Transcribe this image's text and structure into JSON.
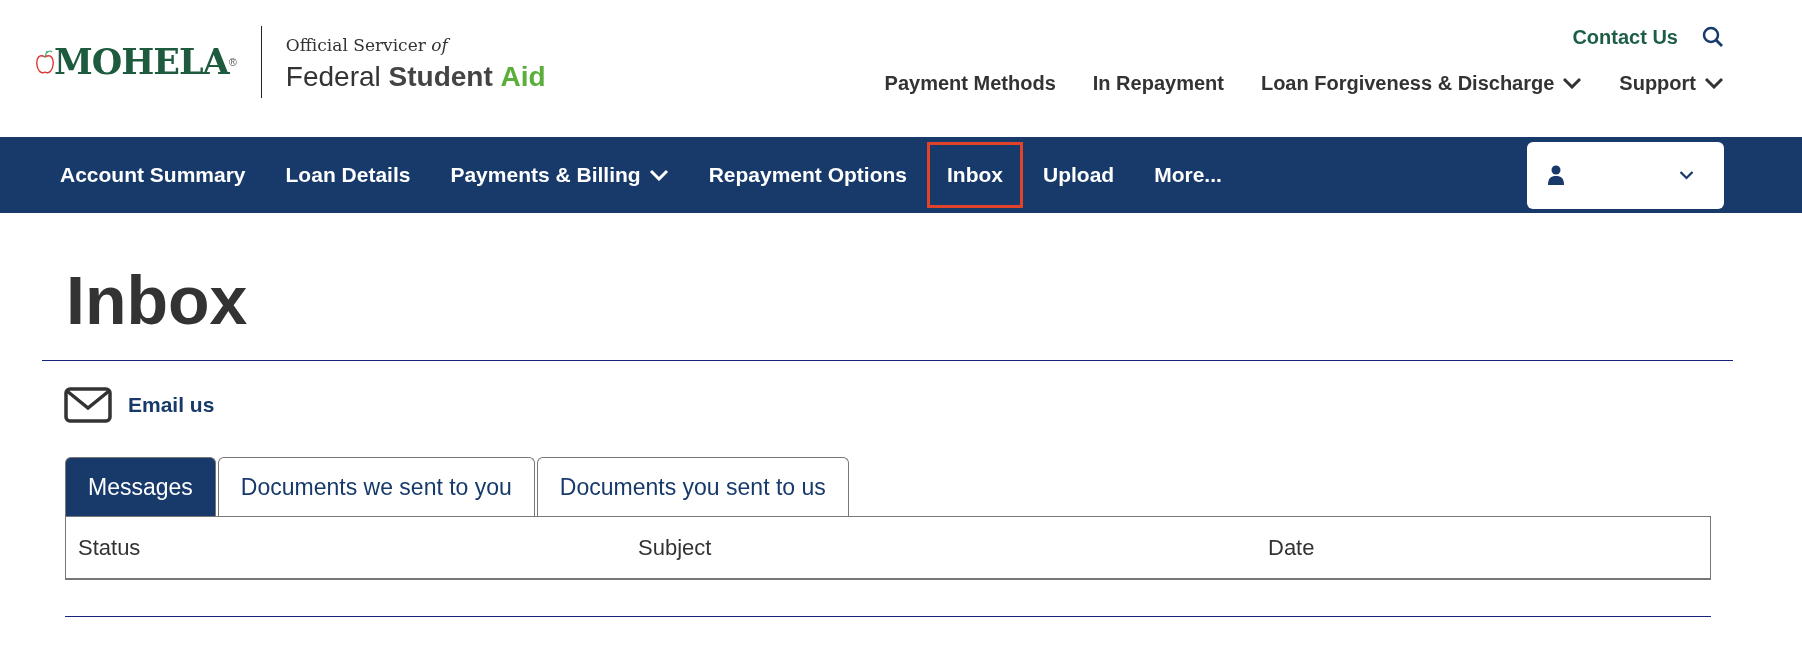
{
  "logo": {
    "brand": "MOHELA",
    "registered": "®",
    "servicer_line": "Official Servicer",
    "servicer_italic": "of",
    "fsa_parts": [
      {
        "text": "Federal",
        "kind": "light"
      },
      {
        "text": "Student",
        "kind": "bold"
      },
      {
        "text": "Aid",
        "kind": "accent"
      }
    ]
  },
  "utility_links": [
    {
      "label": "Contact Us"
    }
  ],
  "top_nav": [
    {
      "label": "Payment Methods",
      "dropdown": false
    },
    {
      "label": "In Repayment",
      "dropdown": false
    },
    {
      "label": "Loan Forgiveness & Discharge",
      "dropdown": true
    },
    {
      "label": "Support",
      "dropdown": true
    }
  ],
  "main_nav": [
    {
      "label": "Account Summary",
      "dropdown": false,
      "selected": false
    },
    {
      "label": "Loan Details",
      "dropdown": false,
      "selected": false
    },
    {
      "label": "Payments & Billing",
      "dropdown": true,
      "selected": false
    },
    {
      "label": "Repayment Options",
      "dropdown": false,
      "selected": false
    },
    {
      "label": "Inbox",
      "dropdown": false,
      "selected": true
    },
    {
      "label": "Upload",
      "dropdown": false,
      "selected": false
    },
    {
      "label": "More...",
      "dropdown": false,
      "selected": false
    }
  ],
  "page_title": "Inbox",
  "email_link": "Email us",
  "tabs": [
    {
      "label": "Messages",
      "selected": true
    },
    {
      "label": "Documents we sent to you",
      "selected": false
    },
    {
      "label": "Documents you sent to us",
      "selected": false
    }
  ],
  "table": {
    "columns": [
      "Status",
      "Subject",
      "Date"
    ]
  }
}
